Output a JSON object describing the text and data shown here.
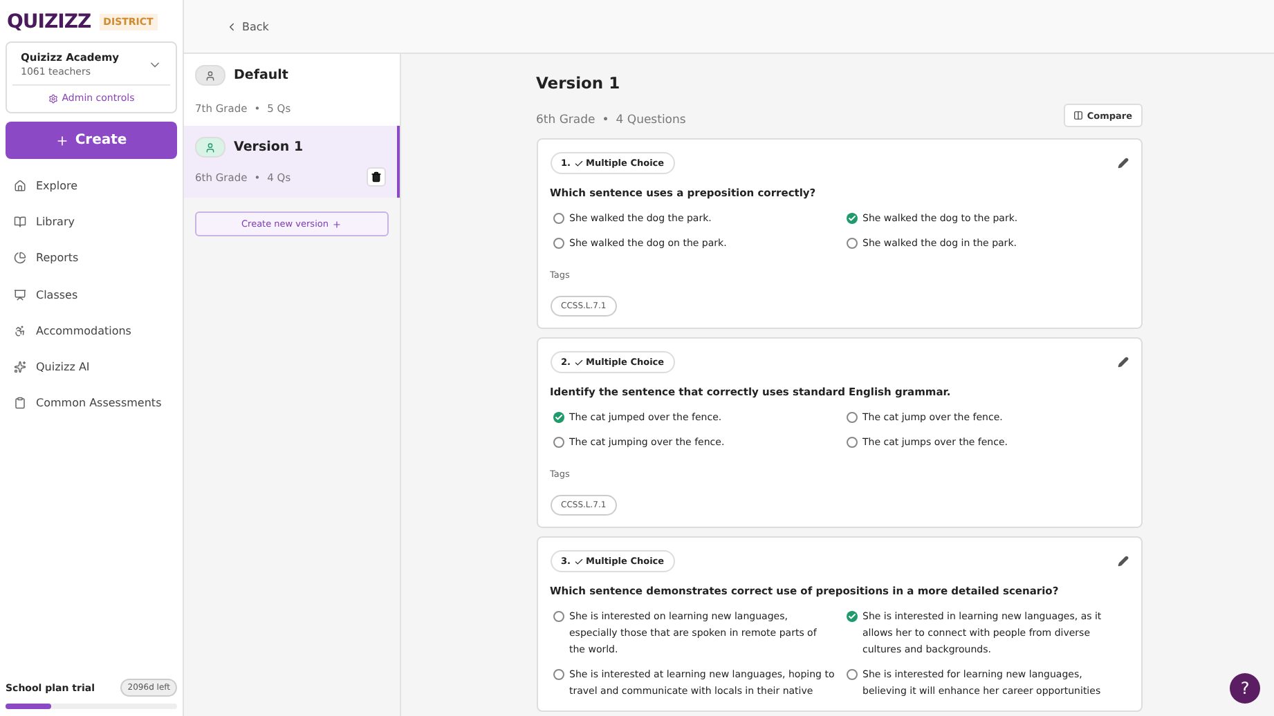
{
  "brand": {
    "logo": "QUIZIZZ",
    "badge": "DISTRICT"
  },
  "org": {
    "name": "Quizizz Academy",
    "members": "1061 teachers",
    "admin_link": "Admin controls"
  },
  "create_button": "Create",
  "nav": [
    {
      "label": "Explore"
    },
    {
      "label": "Library"
    },
    {
      "label": "Reports"
    },
    {
      "label": "Classes"
    },
    {
      "label": "Accommodations"
    },
    {
      "label": "Quizizz AI"
    },
    {
      "label": "Common Assessments"
    }
  ],
  "plan": {
    "label": "School plan trial",
    "remaining": "2096d left",
    "level": 0.27
  },
  "back": "Back",
  "versions": [
    {
      "name": "Default",
      "grade": "7th Grade",
      "separator": "•",
      "count": "5 Qs",
      "selected": false,
      "deletable": false
    },
    {
      "name": "Version 1",
      "grade": "6th Grade",
      "separator": "•",
      "count": "4 Qs",
      "selected": true,
      "deletable": true
    }
  ],
  "create_version": "Create new version",
  "header": {
    "title": "Version 1",
    "grade": "6th Grade",
    "separator": "•",
    "count": "4 Questions",
    "compare": "Compare"
  },
  "questions": [
    {
      "number": "1.",
      "type": "Multiple Choice",
      "text": "Which sentence uses a preposition correctly?",
      "options": [
        {
          "text": "She walked the dog the park.",
          "correct": false
        },
        {
          "text": "She walked the dog to the park.",
          "correct": true
        },
        {
          "text": "She walked the dog on the park.",
          "correct": false
        },
        {
          "text": "She walked the dog in the park.",
          "correct": false
        }
      ],
      "tags_label": "Tags",
      "tags": [
        "CCSS.L.7.1"
      ]
    },
    {
      "number": "2.",
      "type": "Multiple Choice",
      "text": "Identify the sentence that correctly uses standard English grammar.",
      "options": [
        {
          "text": "The cat jumped over the fence.",
          "correct": true
        },
        {
          "text": "The cat jump over the fence.",
          "correct": false
        },
        {
          "text": "The cat jumping over the fence.",
          "correct": false
        },
        {
          "text": "The cat jumps over the fence.",
          "correct": false
        }
      ],
      "tags_label": "Tags",
      "tags": [
        "CCSS.L.7.1"
      ]
    },
    {
      "number": "3.",
      "type": "Multiple Choice",
      "text": "Which sentence demonstrates correct use of prepositions in a more detailed scenario?",
      "options": [
        {
          "text": "She is interested on learning new languages, especially those that are spoken in remote parts of the world.",
          "correct": false
        },
        {
          "text": "She is interested in learning new languages, as it allows her to connect with people from diverse cultures and backgrounds.",
          "correct": true
        },
        {
          "text": "She is interested at learning new languages, hoping to travel and communicate with locals in their native",
          "correct": false
        },
        {
          "text": "She is interested for learning new languages, believing it will enhance her career opportunities",
          "correct": false
        }
      ]
    }
  ],
  "help": "?"
}
